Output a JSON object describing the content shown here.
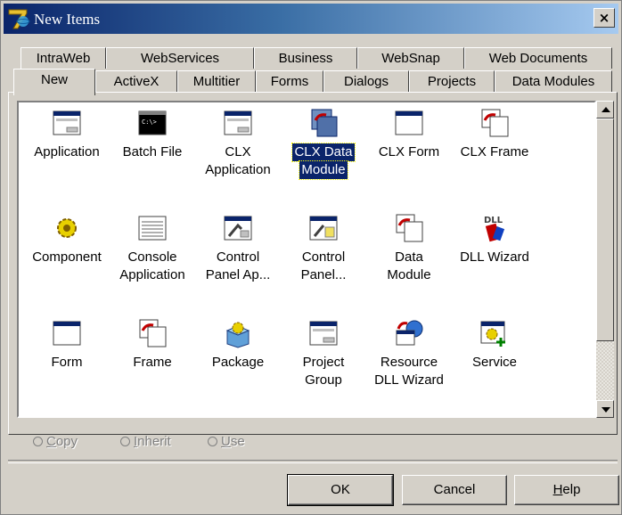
{
  "window": {
    "title": "New Items",
    "close_label": "×"
  },
  "tabs_back": [
    "IntraWeb",
    "WebServices",
    "Business",
    "WebSnap",
    "Web Documents"
  ],
  "tabs_front": [
    "New",
    "ActiveX",
    "Multitier",
    "Forms",
    "Dialogs",
    "Projects",
    "Data Modules"
  ],
  "items": [
    {
      "label1": "Application",
      "label2": "",
      "icon": "application-window-icon"
    },
    {
      "label1": "Batch File",
      "label2": "",
      "icon": "batch-file-icon"
    },
    {
      "label1": "CLX",
      "label2": "Application",
      "icon": "clx-application-icon"
    },
    {
      "label1": "CLX Data",
      "label2": "Module",
      "icon": "clx-data-module-icon",
      "selected": true
    },
    {
      "label1": "CLX Form",
      "label2": "",
      "icon": "clx-form-icon"
    },
    {
      "label1": "CLX Frame",
      "label2": "",
      "icon": "clx-frame-icon"
    },
    {
      "label1": "Component",
      "label2": "",
      "icon": "component-gear-icon"
    },
    {
      "label1": "Console",
      "label2": "Application",
      "icon": "console-application-icon"
    },
    {
      "label1": "Control",
      "label2": "Panel Ap...",
      "icon": "control-panel-application-icon"
    },
    {
      "label1": "Control",
      "label2": "Panel...",
      "icon": "control-panel-module-icon"
    },
    {
      "label1": "Data",
      "label2": "Module",
      "icon": "data-module-icon"
    },
    {
      "label1": "DLL Wizard",
      "label2": "",
      "icon": "dll-wizard-icon"
    },
    {
      "label1": "Form",
      "label2": "",
      "icon": "form-icon"
    },
    {
      "label1": "Frame",
      "label2": "",
      "icon": "frame-icon"
    },
    {
      "label1": "Package",
      "label2": "",
      "icon": "package-icon"
    },
    {
      "label1": "Project",
      "label2": "Group",
      "icon": "project-group-icon"
    },
    {
      "label1": "Resource",
      "label2": "DLL Wizard",
      "icon": "resource-dll-wizard-icon"
    },
    {
      "label1": "Service",
      "label2": "",
      "icon": "service-icon"
    }
  ],
  "options": {
    "copy": {
      "first": "C",
      "rest": "opy"
    },
    "inherit": {
      "first": "I",
      "rest": "nherit"
    },
    "use": {
      "first": "U",
      "rest": "se"
    }
  },
  "buttons": {
    "ok": "OK",
    "cancel": "Cancel",
    "help_first": "H",
    "help_rest": "elp"
  },
  "colors": {
    "title_gradient_start": "#0a246a",
    "title_gradient_end": "#a6caf0",
    "face": "#d4d0c8",
    "selection": "#0a246a"
  }
}
